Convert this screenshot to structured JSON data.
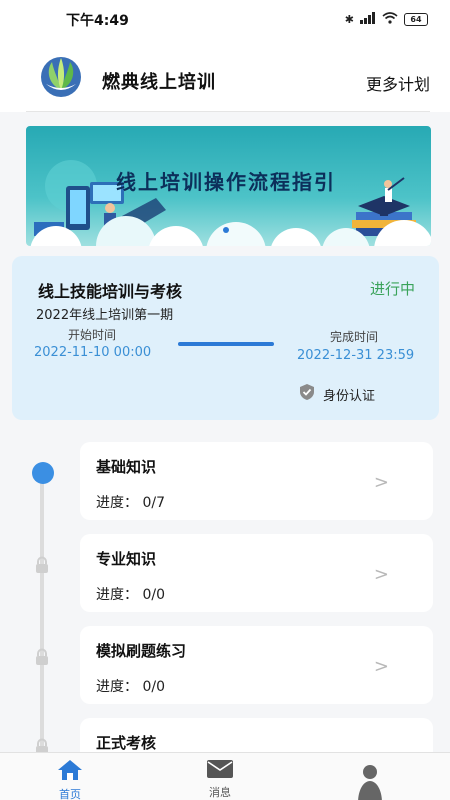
{
  "status_bar": {
    "time": "下午4:49",
    "battery": "64"
  },
  "header": {
    "title": "燃典线上培训",
    "more_label": "更多计划"
  },
  "banner": {
    "title": "线上培训操作流程指引"
  },
  "course": {
    "title": "线上技能培训与考核",
    "subtitle": "2022年线上培训第一期",
    "status": "进行中",
    "start_label": "开始时间",
    "start_value": "2022-11-10 00:00",
    "end_label": "完成时间",
    "end_value": "2022-12-31 23:59",
    "verify_label": "身份认证"
  },
  "modules": [
    {
      "title": "基础知识",
      "progress": "进度：  0/7"
    },
    {
      "title": "专业知识",
      "progress": "进度：  0/0"
    },
    {
      "title": "模拟刷题练习",
      "progress": "进度：  0/0"
    },
    {
      "title": "正式考核",
      "progress": ""
    }
  ],
  "bottom_nav": {
    "home": "首页",
    "messages": "消息",
    "profile": ""
  },
  "colors": {
    "accent": "#3b8fe3",
    "status_green": "#3aa35a",
    "card_bg": "#dff0fb",
    "time_text": "#3a8fd5"
  },
  "icons": {
    "home": "home-icon",
    "messages": "envelope-icon",
    "profile": "user-icon",
    "lock": "lock-icon",
    "verify": "verified-shield-icon",
    "chevron": "chevron-right-icon"
  }
}
